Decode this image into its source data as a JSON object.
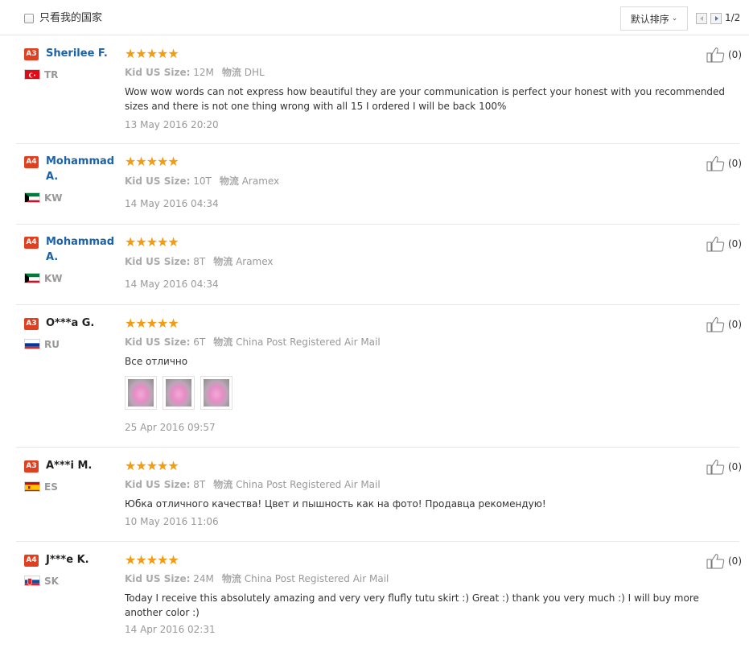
{
  "filter": {
    "label": "只看我的国家"
  },
  "sort": {
    "label": "默认排序"
  },
  "pagination": {
    "page": "1/2"
  },
  "meta_labels": {
    "size_label": "Kid US Size:",
    "shipping_label": "物流"
  },
  "colors": {
    "badge": "#e0401f",
    "star": "#f39c12",
    "name_link": "#1b62a8"
  },
  "icons": {
    "rating": "star-icon",
    "helpful": "thumbs-up-icon",
    "sort": "chevron-down-icon"
  },
  "reviews": [
    {
      "badge": "A3",
      "name": "Sherilee F.",
      "country": "TR",
      "rating": 5,
      "size": "12M",
      "shipping": "DHL",
      "text": "Wow wow words can not express how beautiful they are your communication is perfect your honest with you recommended sizes and there is not one thing wrong with all 15 I ordered I will be back 100%",
      "date": "13 May 2016 20:20",
      "helpful": "(0)"
    },
    {
      "badge": "A4",
      "name": "Mohammad A.",
      "country": "KW",
      "rating": 5,
      "size": "10T",
      "shipping": "Aramex",
      "text": "",
      "date": "14 May 2016 04:34",
      "helpful": "(0)"
    },
    {
      "badge": "A4",
      "name": "Mohammad A.",
      "country": "KW",
      "rating": 5,
      "size": "8T",
      "shipping": "Aramex",
      "text": "",
      "date": "14 May 2016 04:34",
      "helpful": "(0)"
    },
    {
      "badge": "A3",
      "name": "O***a G.",
      "country": "RU",
      "rating": 5,
      "size": "6T",
      "shipping": "China Post Registered Air Mail",
      "text": "Все отлично",
      "photos": 3,
      "date": "25 Apr 2016 09:57",
      "helpful": "(0)"
    },
    {
      "badge": "A3",
      "name": "A***i M.",
      "country": "ES",
      "rating": 5,
      "size": "8T",
      "shipping": "China Post Registered Air Mail",
      "text": "Юбка отличного качества! Цвет и пышность как на фото! Продавца рекомендую!",
      "date": "10 May 2016 11:06",
      "helpful": "(0)"
    },
    {
      "badge": "A4",
      "name": "J***e K.",
      "country": "SK",
      "rating": 5,
      "size": "24M",
      "shipping": "China Post Registered Air Mail",
      "text": "Today I receive this absolutely amazing and very very flufly tutu skirt :) Great :) thank you very much :) I will buy more another color :)",
      "date": "14 Apr 2016 02:31",
      "helpful": "(0)"
    }
  ]
}
